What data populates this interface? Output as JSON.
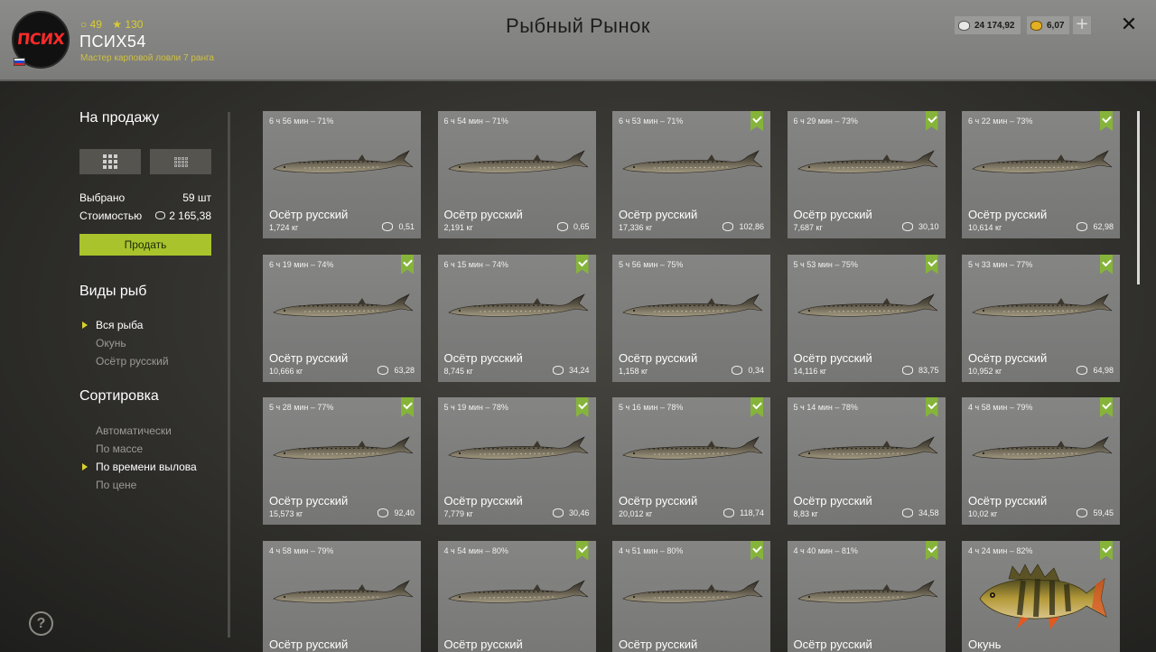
{
  "header": {
    "avatar_text": "ПСИХ",
    "stats": {
      "level": "49",
      "rank_stars": "130"
    },
    "username": "ПСИХ54",
    "rank_title": "Мастер карповой ловли 7 ранга",
    "title": "Рыбный Рынок",
    "silver": "24 174,92",
    "gold": "6,07",
    "plus_label": "+",
    "close_label": "✕"
  },
  "sidebar": {
    "for_sale_heading": "На продажу",
    "selected_label": "Выбрано",
    "selected_value": "59 шт",
    "cost_label": "Стоимостью",
    "cost_value": "2 165,38",
    "sell_label": "Продать",
    "fish_types_heading": "Виды рыб",
    "fish_types": [
      {
        "label": "Вся рыба",
        "active": true
      },
      {
        "label": "Окунь",
        "active": false
      },
      {
        "label": "Осётр русский",
        "active": false
      }
    ],
    "sort_heading": "Сортировка",
    "sort_options": [
      {
        "label": "Автоматически",
        "active": false
      },
      {
        "label": "По массе",
        "active": false
      },
      {
        "label": "По времени вылова",
        "active": true
      },
      {
        "label": "По цене",
        "active": false
      }
    ],
    "help_label": "?"
  },
  "cards": [
    {
      "time": "6 ч 56 мин – 71%",
      "name": "Осётр русский",
      "weight": "1,724 кг",
      "price": "0,51",
      "checked": false,
      "fish": "sturgeon"
    },
    {
      "time": "6 ч 54 мин – 71%",
      "name": "Осётр русский",
      "weight": "2,191 кг",
      "price": "0,65",
      "checked": false,
      "fish": "sturgeon"
    },
    {
      "time": "6 ч 53 мин – 71%",
      "name": "Осётр русский",
      "weight": "17,336 кг",
      "price": "102,86",
      "checked": true,
      "fish": "sturgeon"
    },
    {
      "time": "6 ч 29 мин – 73%",
      "name": "Осётр русский",
      "weight": "7,687 кг",
      "price": "30,10",
      "checked": true,
      "fish": "sturgeon"
    },
    {
      "time": "6 ч 22 мин – 73%",
      "name": "Осётр русский",
      "weight": "10,614 кг",
      "price": "62,98",
      "checked": true,
      "fish": "sturgeon"
    },
    {
      "time": "6 ч 19 мин – 74%",
      "name": "Осётр русский",
      "weight": "10,666 кг",
      "price": "63,28",
      "checked": true,
      "fish": "sturgeon"
    },
    {
      "time": "6 ч 15 мин – 74%",
      "name": "Осётр русский",
      "weight": "8,745 кг",
      "price": "34,24",
      "checked": true,
      "fish": "sturgeon"
    },
    {
      "time": "5 ч 56 мин – 75%",
      "name": "Осётр русский",
      "weight": "1,158 кг",
      "price": "0,34",
      "checked": false,
      "fish": "sturgeon"
    },
    {
      "time": "5 ч 53 мин – 75%",
      "name": "Осётр русский",
      "weight": "14,116 кг",
      "price": "83,75",
      "checked": true,
      "fish": "sturgeon"
    },
    {
      "time": "5 ч 33 мин – 77%",
      "name": "Осётр русский",
      "weight": "10,952 кг",
      "price": "64,98",
      "checked": true,
      "fish": "sturgeon"
    },
    {
      "time": "5 ч 28 мин – 77%",
      "name": "Осётр русский",
      "weight": "15,573 кг",
      "price": "92,40",
      "checked": true,
      "fish": "sturgeon"
    },
    {
      "time": "5 ч 19 мин – 78%",
      "name": "Осётр русский",
      "weight": "7,779 кг",
      "price": "30,46",
      "checked": true,
      "fish": "sturgeon"
    },
    {
      "time": "5 ч 16 мин – 78%",
      "name": "Осётр русский",
      "weight": "20,012 кг",
      "price": "118,74",
      "checked": true,
      "fish": "sturgeon"
    },
    {
      "time": "5 ч 14 мин – 78%",
      "name": "Осётр русский",
      "weight": "8,83 кг",
      "price": "34,58",
      "checked": true,
      "fish": "sturgeon"
    },
    {
      "time": "4 ч 58 мин – 79%",
      "name": "Осётр русский",
      "weight": "10,02 кг",
      "price": "59,45",
      "checked": true,
      "fish": "sturgeon"
    },
    {
      "time": "4 ч 58 мин – 79%",
      "name": "Осётр русский",
      "weight": "",
      "price": "",
      "checked": false,
      "fish": "sturgeon"
    },
    {
      "time": "4 ч 54 мин – 80%",
      "name": "Осётр русский",
      "weight": "",
      "price": "",
      "checked": true,
      "fish": "sturgeon"
    },
    {
      "time": "4 ч 51 мин – 80%",
      "name": "Осётр русский",
      "weight": "",
      "price": "",
      "checked": true,
      "fish": "sturgeon"
    },
    {
      "time": "4 ч 40 мин – 81%",
      "name": "Осётр русский",
      "weight": "",
      "price": "",
      "checked": true,
      "fish": "sturgeon"
    },
    {
      "time": "4 ч 24 мин – 82%",
      "name": "Окунь",
      "weight": "",
      "price": "",
      "checked": true,
      "fish": "perch"
    }
  ],
  "colors": {
    "accent_green": "#a8c32c",
    "badge_green": "#86b43a",
    "active_arrow": "#d7d12e",
    "rank_text": "#cfc040"
  }
}
